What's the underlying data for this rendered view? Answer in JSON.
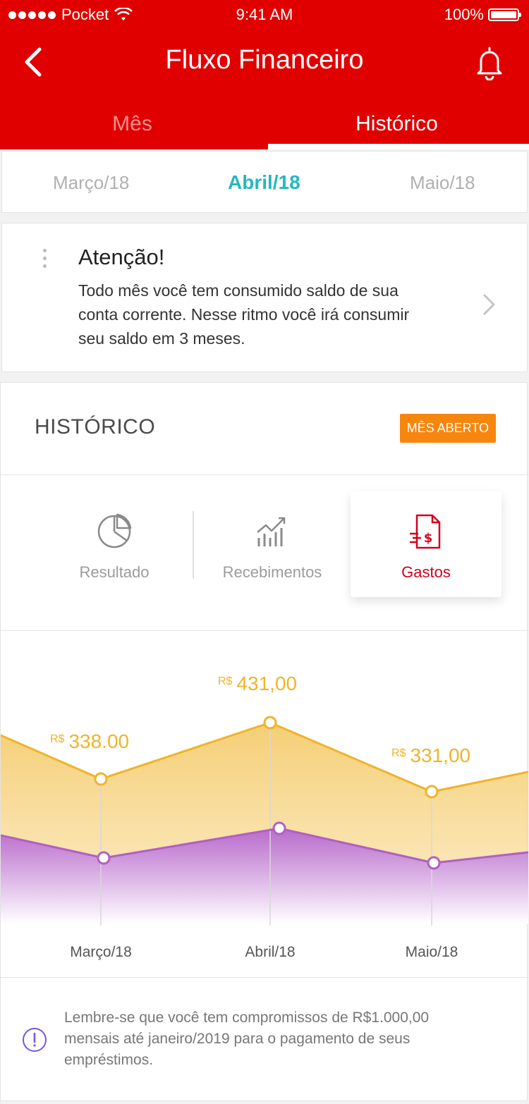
{
  "status_bar": {
    "carrier": "Pocket",
    "time": "9:41 AM",
    "battery": "100%"
  },
  "header": {
    "title": "Fluxo Financeiro",
    "tabs": [
      {
        "label": "Mês"
      },
      {
        "label": "Histórico"
      }
    ],
    "active_tab": "Histórico"
  },
  "months": {
    "prev": "Março/18",
    "current": "Abril/18",
    "next": "Maio/18"
  },
  "alert": {
    "title": "Atenção!",
    "lines": [
      "Todo mês você tem consumido saldo de sua",
      "conta corrente. Nesse ritmo você irá consumir",
      "seu saldo em 3 meses."
    ]
  },
  "historico": {
    "title": "HISTÓRICO",
    "badge": "MÊS ABERTO",
    "segments": [
      {
        "label": "Resultado",
        "icon": "pie-chart-icon"
      },
      {
        "label": "Recebimentos",
        "icon": "growth-chart-icon"
      },
      {
        "label": "Gastos",
        "icon": "expense-document-icon"
      }
    ],
    "active_segment": "Gastos"
  },
  "chart_data": {
    "type": "area",
    "categories": [
      "Março/18",
      "Abril/18",
      "Maio/18"
    ],
    "series": [
      {
        "values": [
          338.0,
          431.0,
          331.0
        ],
        "color": "#f0b429"
      },
      {
        "color": "#b25fcf"
      }
    ],
    "value_labels": [
      {
        "prefix": "R$",
        "text": "338.00"
      },
      {
        "prefix": "R$",
        "text": "431,00"
      },
      {
        "prefix": "R$",
        "text": "331,00"
      }
    ]
  },
  "note": {
    "lines": [
      "Lembre-se que você tem compromissos de R$1.000,00",
      "mensais até janeiro/2019 para o pagamento de seus",
      "empréstimos."
    ]
  },
  "colors": {
    "brand": "#e00000",
    "accent": "#25b8c0",
    "badge": "#f7860e",
    "active_segment": "#d0021b"
  }
}
